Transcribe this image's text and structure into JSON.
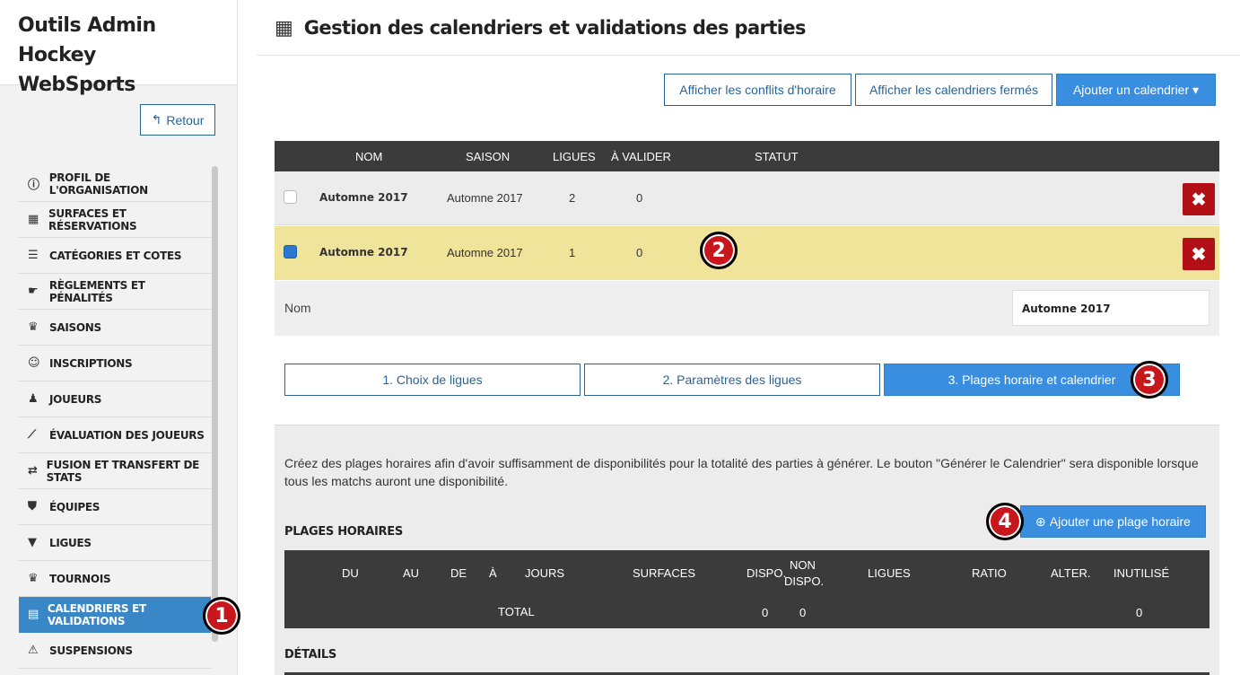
{
  "sidebar": {
    "brand": "Outils Admin Hockey WebSports",
    "back_label": "Retour",
    "items": [
      {
        "label": "PROFIL DE L'ORGANISATION",
        "icon": "ⓘ"
      },
      {
        "label": "SURFACES ET RÉSERVATIONS",
        "icon": "▦"
      },
      {
        "label": "CATÉGORIES ET COTES",
        "icon": "☰"
      },
      {
        "label": "RÈGLEMENTS ET PÉNALITÉS",
        "icon": "☛"
      },
      {
        "label": "SAISONS",
        "icon": "♛"
      },
      {
        "label": "INSCRIPTIONS",
        "icon": "☺"
      },
      {
        "label": "JOUEURS",
        "icon": "♟"
      },
      {
        "label": "ÉVALUATION DES JOUEURS",
        "icon": "⟋"
      },
      {
        "label": "FUSION ET TRANSFERT DE STATS",
        "icon": "⇄"
      },
      {
        "label": "ÉQUIPES",
        "icon": "⛊"
      },
      {
        "label": "LIGUES",
        "icon": "▼"
      },
      {
        "label": "TOURNOIS",
        "icon": "♛"
      },
      {
        "label": "CALENDRIERS ET VALIDATIONS",
        "icon": "▤"
      },
      {
        "label": "SUSPENSIONS",
        "icon": "⚠"
      }
    ]
  },
  "header": {
    "title": "Gestion des calendriers et validations des parties",
    "icon": "calendar-icon"
  },
  "toolbar": {
    "conflicts_label": "Afficher les conflits d'horaire",
    "closed_label": "Afficher les calendriers fermés",
    "add_label": "Ajouter un calendrier ▾"
  },
  "grid": {
    "columns": {
      "nom": "NOM",
      "saison": "SAISON",
      "ligues": "LIGUES",
      "a_valider": "À VALIDER",
      "statut": "STATUT"
    },
    "rows": [
      {
        "nom": "Automne 2017",
        "saison": "Automne 2017",
        "ligues": "2",
        "a_valider": "0"
      },
      {
        "nom": "Automne 2017",
        "saison": "Automne 2017",
        "ligues": "1",
        "a_valider": "0"
      }
    ],
    "delete_glyph": "✖"
  },
  "detail": {
    "name_label": "Nom",
    "name_value": "Automne 2017"
  },
  "steps": {
    "s1": "1. Choix de ligues",
    "s2": "2. Paramètres des ligues",
    "s3": "3. Plages horaire et calendrier"
  },
  "panel": {
    "help": "Créez des plages horaires afin d'avoir suffisamment de disponibilités pour la totalité des parties à générer. Le bouton \"Générer le Calendrier\" sera disponible lorsque tous les matchs auront une disponibilité.",
    "plages_title": "PLAGES HORAIRES",
    "add_plage_label": "Ajouter une plage horaire",
    "details_title": "DÉTAILS",
    "table": {
      "du": "DU",
      "au": "AU",
      "de": "DE",
      "a": "À",
      "jours": "JOURS",
      "surfaces": "SURFACES",
      "dispo": "DISPO.",
      "non_dispo_1": "NON",
      "non_dispo_2": "DISPO.",
      "ligues": "LIGUES",
      "ratio": "RATIO",
      "alter": "ALTER.",
      "inutilise": "INUTILISÉ",
      "total_label": "TOTAL",
      "total_dispo": "0",
      "total_non_dispo": "0",
      "total_inutilise": "0"
    }
  },
  "badges": {
    "b1": "1",
    "b2": "2",
    "b3": "3",
    "b4": "4"
  }
}
